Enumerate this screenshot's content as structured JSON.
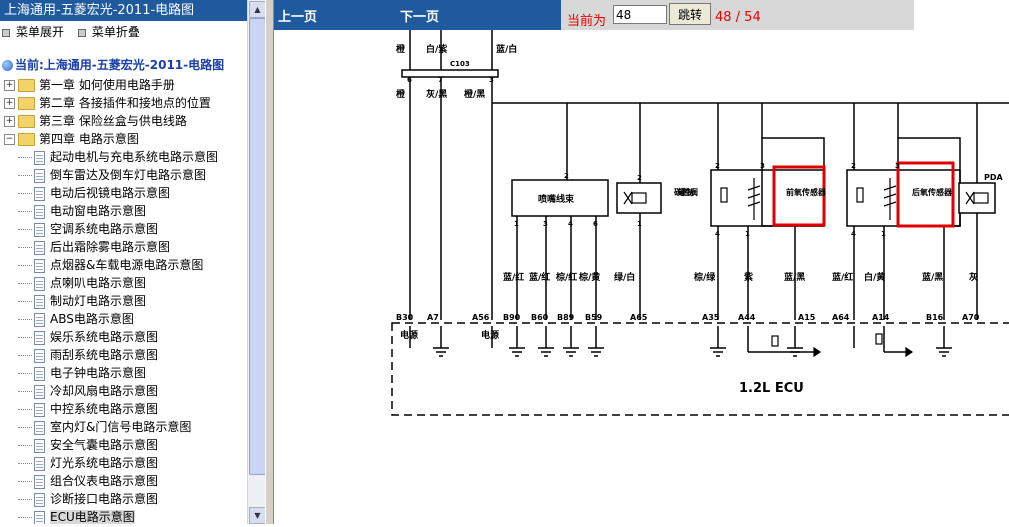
{
  "sidebar": {
    "title": "上海通用-五菱宏光-2011-电路图",
    "menu_expand": "菜单展开",
    "menu_collapse": "菜单折叠",
    "current": "当前:上海通用-五菱宏光-2011-电路图",
    "chapters": [
      {
        "label": "第一章  如何使用电路手册",
        "state": "collapsed"
      },
      {
        "label": "第二章  各接插件和接地点的位置",
        "state": "collapsed"
      },
      {
        "label": "第三章  保险丝盒与供电线路",
        "state": "collapsed"
      },
      {
        "label": "第四章  电路示意图",
        "state": "expanded"
      }
    ],
    "items": [
      "起动电机与充电系统电路示意图",
      "倒车雷达及倒车灯电路示意图",
      "电动后视镜电路示意图",
      "电动窗电路示意图",
      "空调系统电路示意图",
      "后出霜除雾电路示意图",
      "点烟器&车载电源电路示意图",
      "点喇叭电路示意图",
      "制动灯电路示意图",
      "ABS电路示意图",
      "娱乐系统电路示意图",
      "雨刮系统电路示意图",
      "电子钟电路示意图",
      "冷却风扇电路示意图",
      "中控系统电路示意图",
      "室内灯&门信号电路示意图",
      "安全气囊电路示意图",
      "灯光系统电路示意图",
      "组合仪表电路示意图",
      "诊断接口电路示意图",
      "ECU电路示意图"
    ],
    "selected_index": 20
  },
  "toolbar": {
    "prev_page": "上一页",
    "next_page": "下一页",
    "current_label": "当前为",
    "page_value": "48",
    "jump_button": "跳转",
    "page_count": "48 / 54"
  },
  "diagram": {
    "top_wire_labels": [
      "橙",
      "白/紫",
      "蓝/白"
    ],
    "connector": "C103",
    "connector_pins": [
      "6",
      "7",
      "3"
    ],
    "lower_wire_labels": [
      "橙",
      "灰/黑",
      "橙/黑"
    ],
    "component_injector": "喷嘴线束",
    "component_canister": "碳罐控制阀",
    "component_front_o2": "前氧传感器",
    "component_rear_o2": "后氧传感器",
    "component_pda": "PDA",
    "wire_colors": [
      "蓝/红",
      "蓝/红",
      "棕/红",
      "棕/黄",
      "绿/白",
      "棕/绿",
      "紫",
      "蓝/黑",
      "蓝/红",
      "白/黄",
      "蓝/黑",
      "灰"
    ],
    "ecu_pins": [
      "B30",
      "A7",
      "A56",
      "B90",
      "B60",
      "B89",
      "B59",
      "A65",
      "A35",
      "A44",
      "A15",
      "A64",
      "A14",
      "B16",
      "A70"
    ],
    "power_label_1": "电源",
    "power_label_2": "电源",
    "ecu_label": "1.2L ECU",
    "pin_numbers": [
      "2",
      "1",
      "3",
      "4",
      "6",
      "1",
      "2",
      "2",
      "3",
      "4",
      "1",
      "2",
      "3",
      "4",
      "1"
    ],
    "highlight_color": "#e00000"
  }
}
